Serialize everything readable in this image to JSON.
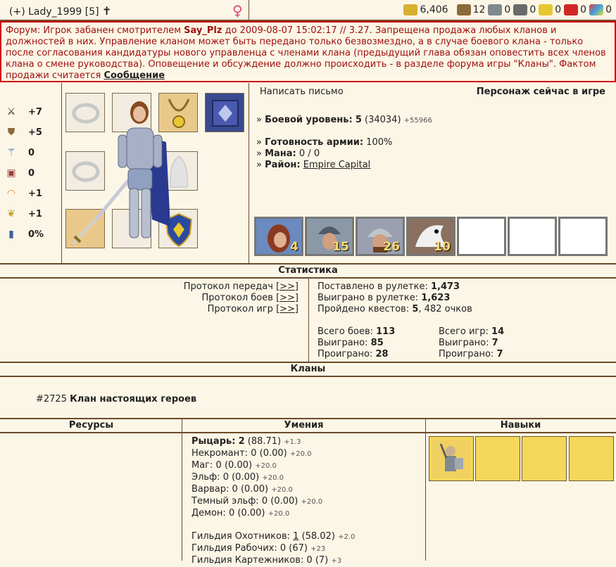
{
  "header": {
    "player": "(+) Lady_1999  [5]",
    "resources": [
      {
        "icon": "gold-icon",
        "value": "6,406"
      },
      {
        "icon": "wood-icon",
        "value": "12"
      },
      {
        "icon": "ore-icon",
        "value": "0"
      },
      {
        "icon": "mercury-icon",
        "value": "0"
      },
      {
        "icon": "sulfur-icon",
        "value": "0"
      },
      {
        "icon": "crystal-icon",
        "value": "0"
      },
      {
        "icon": "gems-icon",
        "value": "0"
      }
    ]
  },
  "notice": {
    "prefix": "Форум: Игрок забанен смотрителем ",
    "moderator": "Say_Plz",
    "body": " до 2009-08-07 15:02:17 // 3.27. Запрещена продажа любых кланов и должностей в них. Управление кланом может быть передано только безвозмездно, а в случае боевого клана - только после согласования кандидатуры нового управленца с членами клана (предыдущий глава обязан оповестить всех членов клана о смене руководства). Оповещение и обсуждение должно происходить - в разделе форума игры \"Кланы\". Фактом продажи считается ",
    "link": "Сообщение"
  },
  "stats": [
    {
      "icon": "attack-icon",
      "value": "+7"
    },
    {
      "icon": "defense-icon",
      "value": "+5"
    },
    {
      "icon": "spellpower-icon",
      "value": "0"
    },
    {
      "icon": "knowledge-icon",
      "value": "0"
    },
    {
      "icon": "luck-icon",
      "value": "+1"
    },
    {
      "icon": "morale-icon",
      "value": "+1"
    },
    {
      "icon": "armor-icon",
      "value": "0%"
    }
  ],
  "info": {
    "write_letter": "Написать письмо",
    "online": "Персонаж сейчас в игре",
    "level_label": "Боевой уровень:",
    "level_value": "5",
    "level_exp": "(34034)",
    "level_next": "+55966",
    "army_label": "Готовность армии:",
    "army_value": "100%",
    "mana_label": "Мана:",
    "mana_value": "0 / 0",
    "district_label": "Район:",
    "district_value": "Empire Capital"
  },
  "army": [
    "4",
    "15",
    "26",
    "10",
    "",
    "",
    ""
  ],
  "sections": {
    "statistics": "Статистика",
    "clans": "Кланы",
    "resources": "Ресурсы",
    "skills": "Умения",
    "talents": "Навыки"
  },
  "protocols": [
    {
      "label": "Протокол передач ",
      "link": "[>>]"
    },
    {
      "label": "Протокол боев ",
      "link": "[>>]"
    },
    {
      "label": "Протокол игр ",
      "link": "[>>]"
    }
  ],
  "roulette": {
    "placed_label": "Поставлено в рулетке:",
    "placed": "1,473",
    "won_label": "Выиграно в рулетке:",
    "won": "1,623",
    "quests_label": "Пройдено квестов:",
    "quests": "5",
    "quests_rest": ", 482 очков"
  },
  "battles": {
    "total_label": "Всего боев:",
    "total": "113",
    "won_label": "Выиграно:",
    "won": "85",
    "lost_label": "Проиграно:",
    "lost": "28"
  },
  "games": {
    "total_label": "Всего игр:",
    "total": "14",
    "won_label": "Выиграно:",
    "won": "7",
    "lost_label": "Проиграно:",
    "lost": "7"
  },
  "clan": {
    "id": "#2725",
    "name": "Клан настоящих героев"
  },
  "skills": [
    {
      "name": "Рыцарь:",
      "value": "2",
      "extra": "(88.71)",
      "bonus": "+1.3",
      "bold": true
    },
    {
      "name": "Некромант:",
      "value": "0",
      "extra": "(0.00)",
      "bonus": "+20.0"
    },
    {
      "name": "Маг:",
      "value": "0",
      "extra": "(0.00)",
      "bonus": "+20.0"
    },
    {
      "name": "Эльф:",
      "value": "0",
      "extra": "(0.00)",
      "bonus": "+20.0"
    },
    {
      "name": "Варвар:",
      "value": "0",
      "extra": "(0.00)",
      "bonus": "+20.0"
    },
    {
      "name": "Темный эльф:",
      "value": "0",
      "extra": "(0.00)",
      "bonus": "+20.0"
    },
    {
      "name": "Демон:",
      "value": "0",
      "extra": "(0.00)",
      "bonus": "+20.0"
    }
  ],
  "guilds": [
    {
      "name": "Гильдия Охотников:",
      "value": "1",
      "extra": "(58.02)",
      "bonus": "+2.0"
    },
    {
      "name": "Гильдия Рабочих:",
      "value": "0",
      "extra": "(67)",
      "bonus": "+23"
    },
    {
      "name": "Гильдия Картежников:",
      "value": "0",
      "extra": "(7)",
      "bonus": "+3"
    }
  ]
}
